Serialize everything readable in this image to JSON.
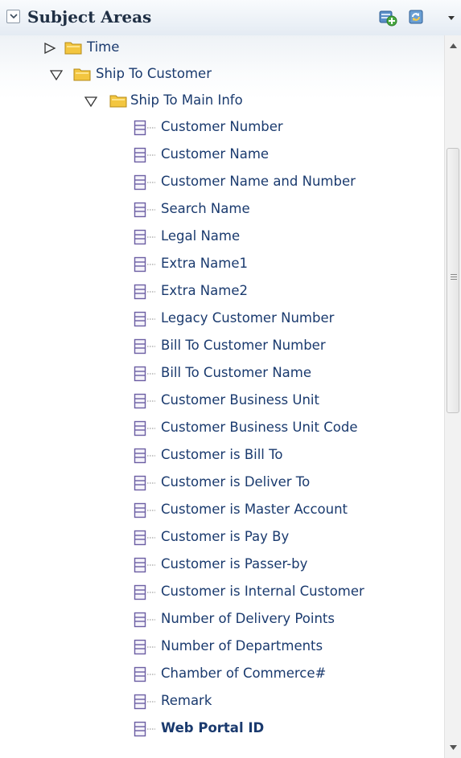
{
  "panel": {
    "title": "Subject Areas",
    "header_icons": [
      "add-subject-area-icon",
      "refresh-icon"
    ],
    "toolbar_menu_icon": "chevron-down-icon"
  },
  "tree": {
    "folders": [
      {
        "label": "Time",
        "expanded": false
      },
      {
        "label": "Ship To Customer",
        "expanded": true
      },
      {
        "label": "Ship To Main Info",
        "expanded": true
      }
    ],
    "columns": [
      {
        "label": "Customer Number"
      },
      {
        "label": "Customer Name"
      },
      {
        "label": "Customer Name and Number"
      },
      {
        "label": "Search Name"
      },
      {
        "label": "Legal Name"
      },
      {
        "label": "Extra Name1"
      },
      {
        "label": "Extra Name2"
      },
      {
        "label": "Legacy Customer Number"
      },
      {
        "label": "Bill To Customer Number"
      },
      {
        "label": "Bill To Customer Name"
      },
      {
        "label": "Customer Business Unit"
      },
      {
        "label": "Customer Business Unit Code"
      },
      {
        "label": "Customer is Bill To"
      },
      {
        "label": "Customer is Deliver To"
      },
      {
        "label": "Customer is Master Account"
      },
      {
        "label": "Customer is Pay By"
      },
      {
        "label": "Customer is Passer-by"
      },
      {
        "label": "Customer is Internal Customer"
      },
      {
        "label": "Number of Delivery Points"
      },
      {
        "label": "Number of Departments"
      },
      {
        "label": "Chamber of Commerce#"
      },
      {
        "label": "Remark"
      },
      {
        "label": "Web Portal ID",
        "bold": true
      }
    ]
  },
  "colors": {
    "label_text": "#1a3a6e",
    "header_text": "#1f2f44",
    "folder": "#e8b830",
    "column_icon": "#7a6aa8"
  }
}
